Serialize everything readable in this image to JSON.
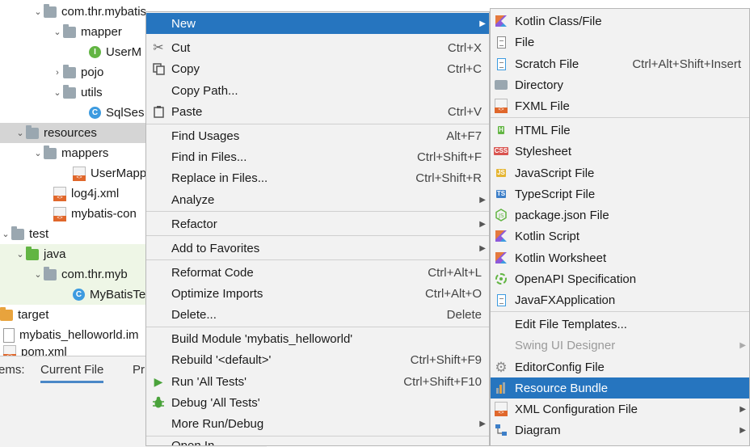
{
  "project_tree": {
    "rows": [
      {
        "label": "com.thr.mybatis",
        "indent": 1,
        "arrow": "v",
        "icon": "package"
      },
      {
        "label": "mapper",
        "indent": 2,
        "arrow": "v",
        "icon": "package"
      },
      {
        "label": "UserM",
        "indent": 3,
        "arrow": "",
        "icon": "interface"
      },
      {
        "label": "pojo",
        "indent": 2,
        "arrow": ">",
        "icon": "package"
      },
      {
        "label": "utils",
        "indent": 2,
        "arrow": "v",
        "icon": "package"
      },
      {
        "label": "SqlSes",
        "indent": 3,
        "arrow": "",
        "icon": "class"
      },
      {
        "label": "resources",
        "indent": 1,
        "arrow": "v",
        "icon": "resources-folder"
      },
      {
        "label": "mappers",
        "indent": 2,
        "arrow": "v",
        "icon": "folder"
      },
      {
        "label": "UserMapp",
        "indent": 3,
        "arrow": "",
        "icon": "xml"
      },
      {
        "label": "log4j.xml",
        "indent": 2,
        "arrow": "",
        "icon": "xml"
      },
      {
        "label": "mybatis-con",
        "indent": 2,
        "arrow": "",
        "icon": "xml"
      },
      {
        "label": "test",
        "indent": 0,
        "arrow": "v",
        "icon": "folder"
      },
      {
        "label": "java",
        "indent": 1,
        "arrow": "v",
        "icon": "test-folder"
      },
      {
        "label": "com.thr.myb",
        "indent": 2,
        "arrow": "v",
        "icon": "package"
      },
      {
        "label": "MyBatisTe",
        "indent": 3,
        "arrow": "",
        "icon": "test-class"
      },
      {
        "label": "target",
        "indent": 0,
        "arrow": "",
        "icon": "excluded-folder"
      },
      {
        "label": "mybatis_helloworld.im",
        "indent": 0,
        "arrow": "",
        "icon": "file"
      },
      {
        "label": "pom.xml",
        "indent": 0,
        "arrow": "",
        "icon": "xml"
      }
    ]
  },
  "bottom_tabs": {
    "items_label": "ems:",
    "current_file": "Current File",
    "problems": "Pr"
  },
  "context_menu": {
    "items": [
      {
        "label": "New",
        "shortcut": "",
        "submenu": true,
        "highlighted": true,
        "icon": ""
      },
      {
        "label": "Cut",
        "shortcut": "Ctrl+X",
        "icon": "scissors-icon"
      },
      {
        "label": "Copy",
        "shortcut": "Ctrl+C",
        "icon": "copy-icon"
      },
      {
        "label": "Copy Path...",
        "shortcut": "",
        "icon": ""
      },
      {
        "label": "Paste",
        "shortcut": "Ctrl+V",
        "icon": "paste-icon"
      },
      {
        "label": "Find Usages",
        "shortcut": "Alt+F7",
        "icon": ""
      },
      {
        "label": "Find in Files...",
        "shortcut": "Ctrl+Shift+F",
        "icon": ""
      },
      {
        "label": "Replace in Files...",
        "shortcut": "Ctrl+Shift+R",
        "icon": ""
      },
      {
        "label": "Analyze",
        "shortcut": "",
        "submenu": true,
        "icon": ""
      },
      {
        "label": "Refactor",
        "shortcut": "",
        "submenu": true,
        "icon": ""
      },
      {
        "label": "Add to Favorites",
        "shortcut": "",
        "submenu": true,
        "icon": ""
      },
      {
        "label": "Reformat Code",
        "shortcut": "Ctrl+Alt+L",
        "icon": ""
      },
      {
        "label": "Optimize Imports",
        "shortcut": "Ctrl+Alt+O",
        "icon": ""
      },
      {
        "label": "Delete...",
        "shortcut": "Delete",
        "icon": ""
      },
      {
        "label": "Build Module 'mybatis_helloworld'",
        "shortcut": "",
        "icon": ""
      },
      {
        "label": "Rebuild '<default>'",
        "shortcut": "Ctrl+Shift+F9",
        "icon": ""
      },
      {
        "label": "Run 'All Tests'",
        "shortcut": "Ctrl+Shift+F10",
        "icon": "run-icon"
      },
      {
        "label": "Debug 'All Tests'",
        "shortcut": "",
        "icon": "debug-icon"
      },
      {
        "label": "More Run/Debug",
        "shortcut": "",
        "submenu": true,
        "icon": ""
      },
      {
        "label": "Open In",
        "shortcut": "",
        "icon": ""
      }
    ]
  },
  "new_submenu": {
    "items": [
      {
        "label": "Kotlin Class/File",
        "shortcut": "",
        "icon": "kotlin-icon"
      },
      {
        "label": "File",
        "shortcut": "",
        "icon": "file-icon"
      },
      {
        "label": "Scratch File",
        "shortcut": "Ctrl+Alt+Shift+Insert",
        "icon": "scratch-file-icon"
      },
      {
        "label": "Directory",
        "shortcut": "",
        "icon": "directory-icon"
      },
      {
        "label": "FXML File",
        "shortcut": "",
        "icon": "fxml-icon"
      },
      {
        "label": "HTML File",
        "shortcut": "",
        "icon": "html-icon"
      },
      {
        "label": "Stylesheet",
        "shortcut": "",
        "icon": "css-icon"
      },
      {
        "label": "JavaScript File",
        "shortcut": "",
        "icon": "js-icon"
      },
      {
        "label": "TypeScript File",
        "shortcut": "",
        "icon": "ts-icon"
      },
      {
        "label": "package.json File",
        "shortcut": "",
        "icon": "nodejs-icon"
      },
      {
        "label": "Kotlin Script",
        "shortcut": "",
        "icon": "kotlin-script-icon"
      },
      {
        "label": "Kotlin Worksheet",
        "shortcut": "",
        "icon": "kotlin-worksheet-icon"
      },
      {
        "label": "OpenAPI Specification",
        "shortcut": "",
        "icon": "openapi-icon"
      },
      {
        "label": "JavaFXApplication",
        "shortcut": "",
        "icon": "javafx-icon"
      },
      {
        "label": "Edit File Templates...",
        "shortcut": "",
        "icon": ""
      },
      {
        "label": "Swing UI Designer",
        "shortcut": "",
        "icon": "",
        "disabled": true,
        "submenu": true
      },
      {
        "label": "EditorConfig File",
        "shortcut": "",
        "icon": "gear-icon"
      },
      {
        "label": "Resource Bundle",
        "shortcut": "",
        "icon": "resource-bundle-icon",
        "highlighted": true
      },
      {
        "label": "XML Configuration File",
        "shortcut": "",
        "icon": "xml-config-icon",
        "submenu": true
      },
      {
        "label": "Diagram",
        "shortcut": "",
        "icon": "diagram-icon",
        "submenu": true
      }
    ]
  },
  "colors": {
    "highlight": "#2675bf",
    "menu_bg": "#f2f2f2",
    "selection_row": "#d5d5d5"
  }
}
